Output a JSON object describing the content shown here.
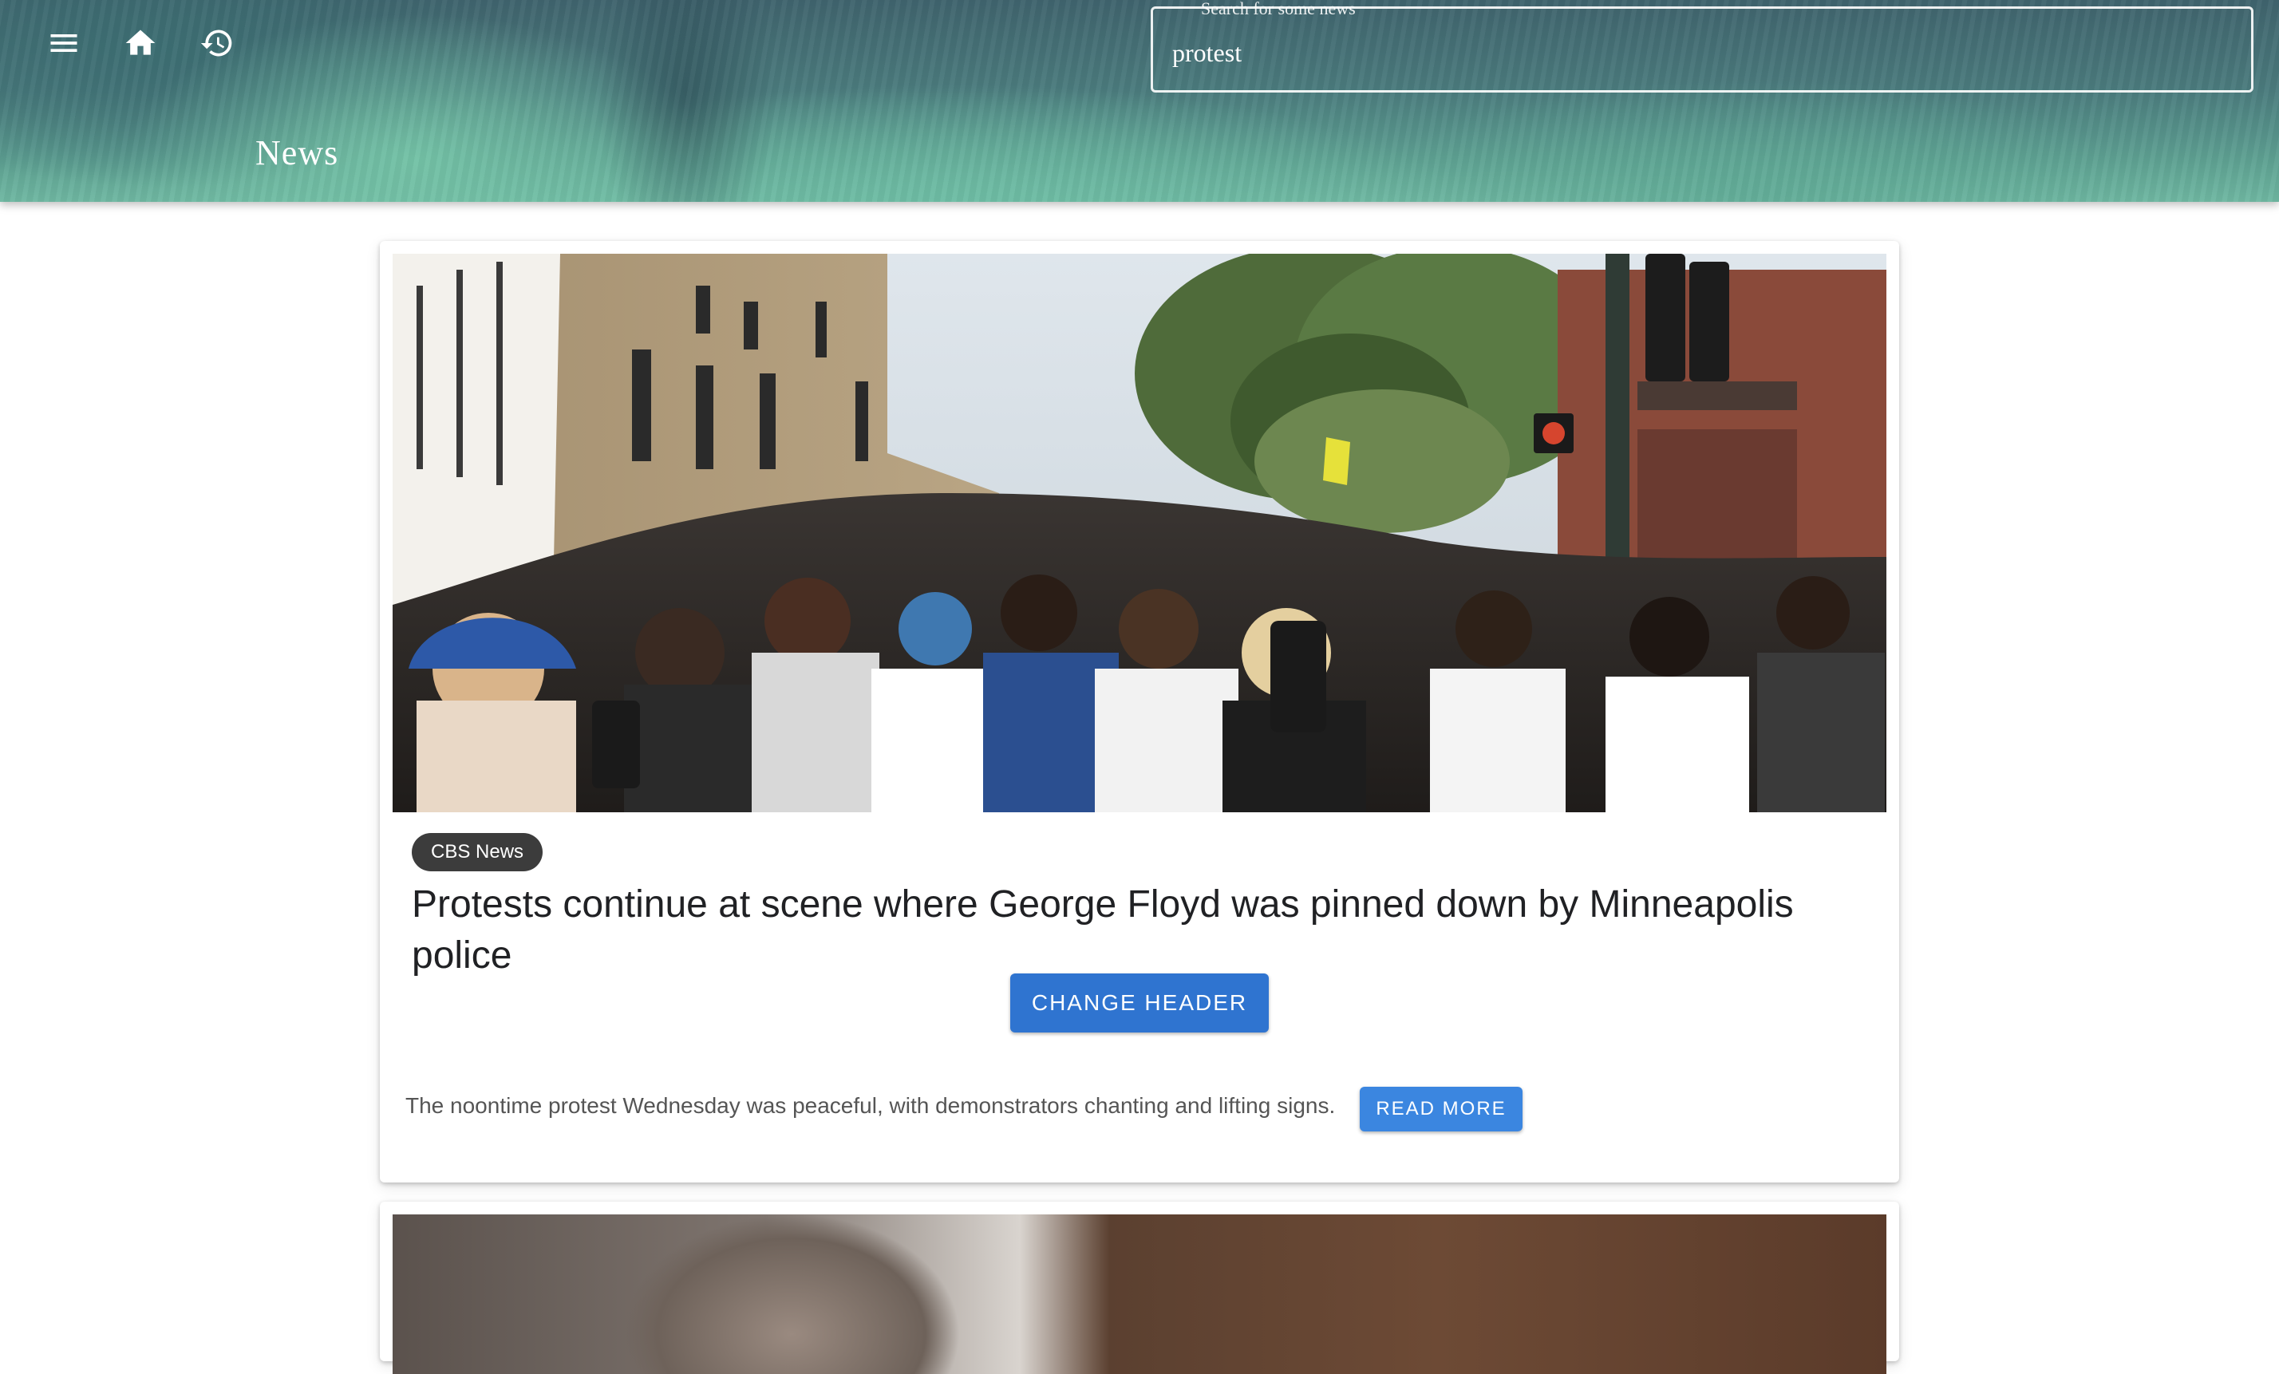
{
  "header": {
    "app_title": "News",
    "icons": {
      "menu": "menu-icon",
      "home": "home-icon",
      "history": "history-icon"
    },
    "search": {
      "label": "Search for some news",
      "value": "protest"
    }
  },
  "articles": [
    {
      "source": "CBS News",
      "title": "Protests continue at scene where George Floyd was pinned down by Minneapolis police",
      "change_header_label": "CHANGE HEADER",
      "description": "The noontime protest Wednesday was peaceful, with demonstrators chanting and lifting signs.",
      "read_more_label": "READ MORE"
    },
    {
      "source": "",
      "title": ""
    }
  ],
  "colors": {
    "header_teal": "#4b7c7e",
    "primary_button": "#2f74d0",
    "secondary_button": "#3b86e0",
    "chip_background": "#3c3c3c",
    "title_text": "#202124"
  }
}
